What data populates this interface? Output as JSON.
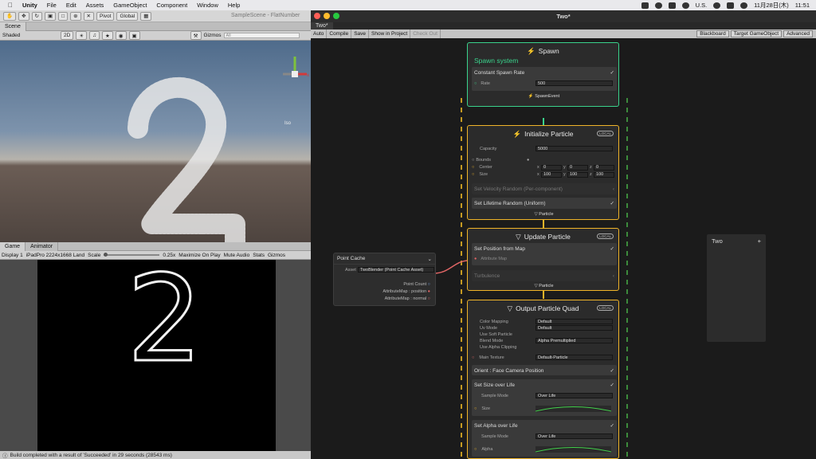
{
  "menubar": {
    "app": "Unity",
    "items": [
      "File",
      "Edit",
      "Assets",
      "GameObject",
      "Component",
      "Window",
      "Help"
    ],
    "locale": "U.S.",
    "datetime": "11月28日(木)",
    "time": "11:51"
  },
  "unity": {
    "window_title": "SampleScene - FlatNumber",
    "pivot": "Pivot",
    "global": "Global",
    "scene_tab": "Scene",
    "shading": "Shaded",
    "mode2d": "2D",
    "gizmos": "Gizmos",
    "search_placeholder": "All",
    "view_label": "Iso",
    "game_tab": "Game",
    "animator_tab": "Animator",
    "display": "Display 1",
    "resolution": "iPadPro 2224x1668 Land",
    "scale_label": "Scale",
    "scale_value": "0.25x",
    "maximize": "Maximize On Play",
    "mute": "Mute Audio",
    "stats": "Stats",
    "game_gizmos": "Gizmos",
    "digit": "2",
    "status": "Build completed with a result of 'Succeeded' in 29 seconds (28543 ms)"
  },
  "vfx": {
    "title": "Two*",
    "tab": "Two*",
    "toolbar": [
      "Auto",
      "Compile",
      "Save",
      "Show in Project",
      "Check Out"
    ],
    "right_tools": [
      "Blackboard",
      "Target GameObject",
      "Advanced"
    ],
    "spawn": {
      "title": "Spawn",
      "system_name": "Spawn system",
      "block": "Constant Spawn Rate",
      "rate_label": "Rate",
      "rate_value": "500",
      "event": "SpawnEvent"
    },
    "init": {
      "title": "Initialize Particle",
      "local": "LOCAL",
      "capacity_label": "Capacity",
      "capacity": "5000",
      "bounds": "Bounds",
      "center": "Center",
      "size": "Size",
      "center_vals": [
        "0",
        "0",
        "0"
      ],
      "size_vals": [
        "100",
        "100",
        "100"
      ],
      "axes": [
        "x",
        "y",
        "z"
      ],
      "block1": "Set Velocity Random (Per-component)",
      "block2": "Set Lifetime Random (Uniform)",
      "flow": "Particle"
    },
    "update": {
      "title": "Update Particle",
      "local": "LOCAL",
      "block1": "Set Position from Map",
      "attr_map": "Attribute Map",
      "block2": "Turbulence",
      "flow": "Particle"
    },
    "output": {
      "title": "Output Particle Quad",
      "local": "LOCAL",
      "rows": [
        "Color Mapping",
        "Uv Mode",
        "Use Soft Particle",
        "Blend Mode",
        "Use Alpha Clipping"
      ],
      "values": [
        "Default",
        "Default",
        "",
        "Alpha Premultiplied",
        ""
      ],
      "main_texture": "Main Texture",
      "texture_value": "Default-Particle",
      "orient": "Orient : Face Camera Position",
      "size_block": "Set Size over Life",
      "sample_mode": "Sample Mode",
      "over_life": "Over Life",
      "size_label": "Size",
      "alpha_block": "Set Alpha over Life",
      "alpha_label": "Alpha"
    },
    "point_cache": {
      "title": "Point Cache",
      "asset_label": "Asset",
      "asset_value": "TwoBlender (Point Cache Asset)",
      "slots": [
        "Point Count",
        "AttributeMap : position",
        "AttributeMap : normal"
      ]
    },
    "blackboard": {
      "title": "Two",
      "add": "+"
    }
  }
}
